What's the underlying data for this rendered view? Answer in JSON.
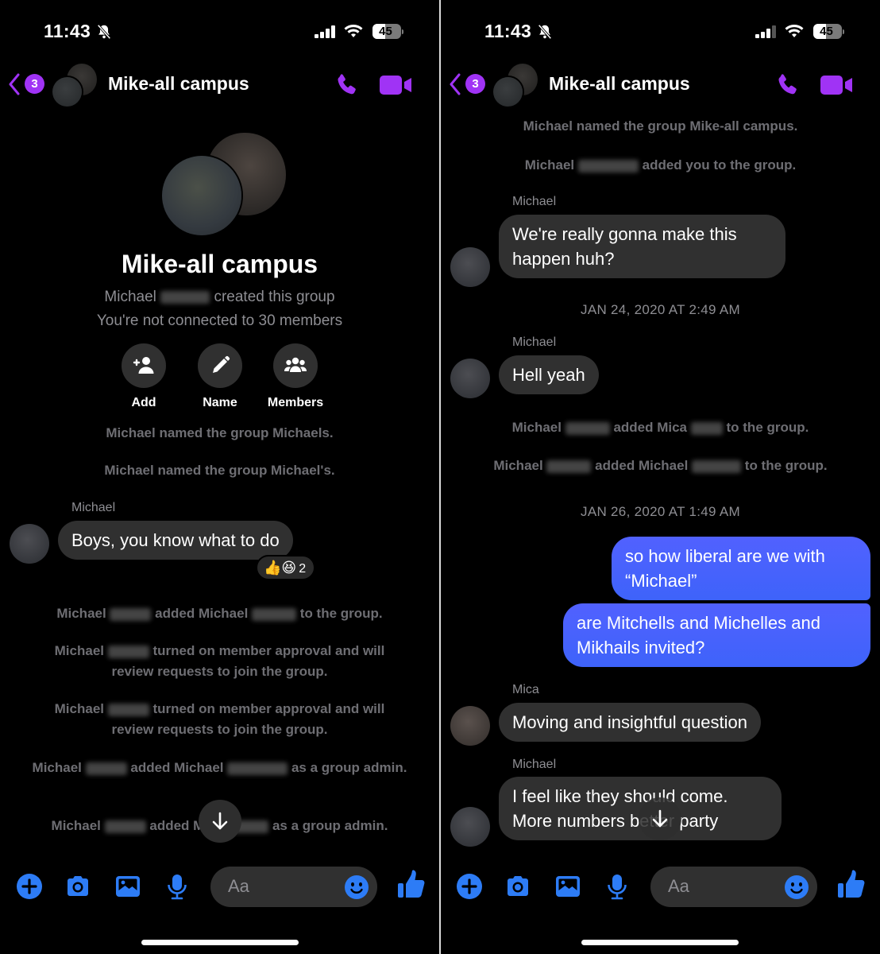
{
  "status_bar": {
    "time": "11:43",
    "battery": "45",
    "battery_level": 0.45
  },
  "colors": {
    "accent_purple": "#a033f5",
    "accent_blue": "#2d7cf6",
    "outgoing_bubble": "#4a62fd",
    "incoming_bubble": "#303030"
  },
  "header": {
    "back_badge": "3",
    "title": "Mike-all campus"
  },
  "left": {
    "hero": {
      "title": "Mike-all campus",
      "created_prefix": "Michael",
      "created_suffix": "created this group",
      "not_connected": "You're not connected to 30 members"
    },
    "actions": [
      {
        "label": "Add",
        "icon": "add-person-icon"
      },
      {
        "label": "Name",
        "icon": "pencil-icon"
      },
      {
        "label": "Members",
        "icon": "group-icon"
      }
    ],
    "system_1": "Michael named the group Michaels.",
    "system_2": "Michael named the group Michael's.",
    "msg_1": {
      "sender": "Michael",
      "text": "Boys, you know what to do",
      "reactions": "👍😆",
      "reaction_count": "2"
    },
    "system_3": {
      "a": "Michael",
      "b": "added Michael",
      "c": "to the group."
    },
    "system_4": {
      "a": "Michael",
      "b": "turned on member approval and will review requests to join the group."
    },
    "system_5": {
      "a": "Michael",
      "b": "turned on member approval and will review requests to join the group."
    },
    "system_6": {
      "a": "Michael",
      "b": "added Michael",
      "c": "as a group admin."
    },
    "system_7": {
      "a": "Michael",
      "b": "added Mic",
      "c": "as a group admin."
    }
  },
  "right": {
    "system_1": "Michael named the group Mike-all campus.",
    "system_2": {
      "a": "Michael",
      "b": "added you to the group."
    },
    "msg_1": {
      "sender": "Michael",
      "text": "We're really gonna make this happen huh?"
    },
    "stamp_1": "JAN 24, 2020 AT 2:49 AM",
    "msg_2": {
      "sender": "Michael",
      "text": "Hell yeah"
    },
    "system_3": {
      "a": "Michael",
      "b": "added Mica",
      "c": "to the group."
    },
    "system_4": {
      "a": "Michael",
      "b": "added Michael",
      "c": "to the group."
    },
    "stamp_2": "JAN 26, 2020 AT 1:49 AM",
    "out_1": "so how liberal are we with “Michael”",
    "out_2": "are Mitchells and Michelles and Mikhails invited?",
    "msg_3": {
      "sender": "Mica",
      "text": "Moving and insightful question"
    },
    "msg_4": {
      "sender": "Michael",
      "text": "I feel like they should come. More numbers better party"
    }
  },
  "composer": {
    "placeholder": "Aa"
  }
}
